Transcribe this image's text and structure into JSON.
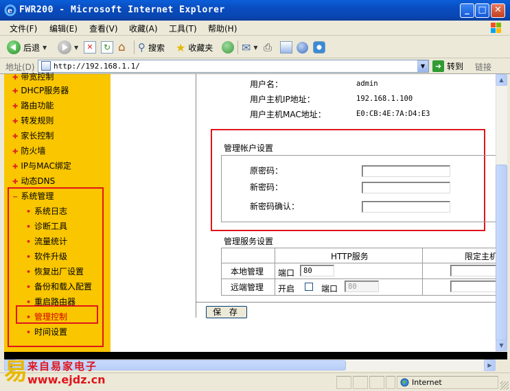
{
  "window": {
    "title": "FWR200 - Microsoft Internet Explorer"
  },
  "menu": [
    "文件(F)",
    "编辑(E)",
    "查看(V)",
    "收藏(A)",
    "工具(T)",
    "帮助(H)"
  ],
  "toolbar": {
    "back_label": "后退",
    "search_label": "搜索",
    "favorites_label": "收藏夹"
  },
  "address": {
    "label": "地址(D)",
    "url": "http://192.168.1.1/",
    "go_label": "转到",
    "links_label": "链接"
  },
  "sidebar": {
    "partial_top": "带宽控制",
    "items": [
      "DHCP服务器",
      "路由功能",
      "转发规则",
      "家长控制",
      "防火墙",
      "IP与MAC绑定",
      "动态DNS"
    ],
    "expanded": "系统管理",
    "subitems": [
      "系统日志",
      "诊断工具",
      "流量统计",
      "软件升级",
      "恢复出厂设置",
      "备份和载入配置",
      "重启路由器",
      "管理控制",
      "时间设置"
    ]
  },
  "info": {
    "user_label": "用户名：",
    "user_value": "admin",
    "ip_label": "用户主机IP地址：",
    "ip_value": "192.168.1.100",
    "mac_label": "用户主机MAC地址：",
    "mac_value": "E0:CB:4E:7A:D4:E3"
  },
  "account": {
    "section_title": "管理帐户设置",
    "old_password_label": "原密码：",
    "new_password_label": "新密码：",
    "confirm_password_label": "新密码确认："
  },
  "service": {
    "section_title": "管理服务设置",
    "col_http": "HTTP服务",
    "col_limit": "限定主机",
    "local_label": "本地管理",
    "remote_label": "远端管理",
    "port_label": "端口",
    "enable_label": "开启",
    "local_port": "80",
    "remote_port": "80"
  },
  "save_label": "保 存",
  "status": {
    "zone": "Internet"
  },
  "watermark": {
    "line1": "来自易家电子",
    "line2": "www.ejdz.cn"
  }
}
